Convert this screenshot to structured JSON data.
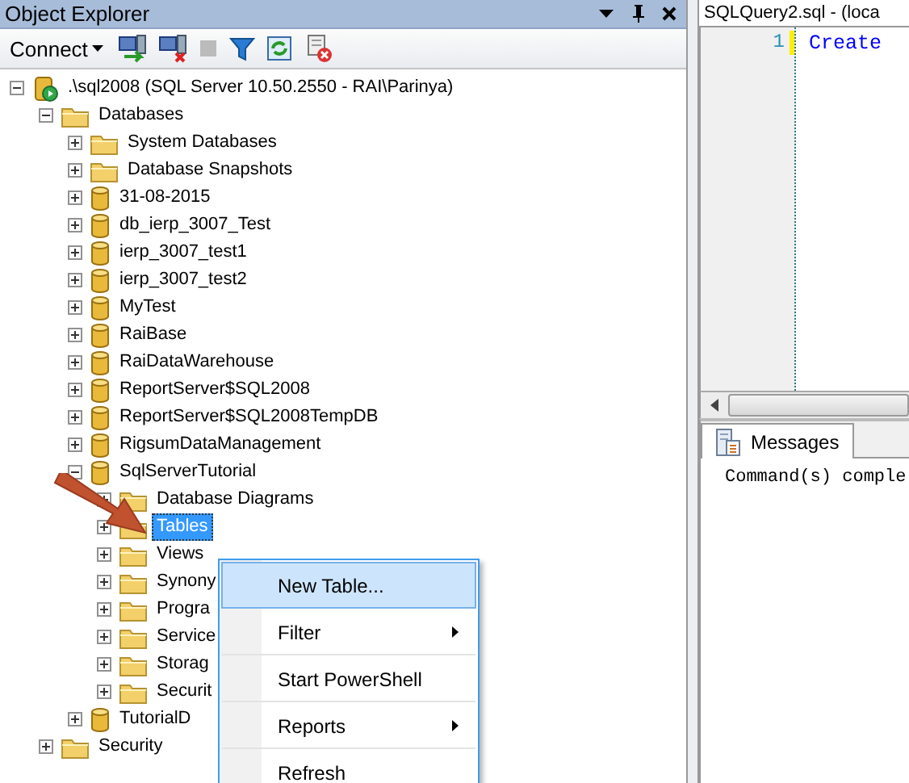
{
  "object_explorer": {
    "title": "Object Explorer",
    "toolbar": {
      "connect": "Connect"
    },
    "tree": [
      {
        "label": ".\\sql2008 (SQL Server 10.50.2550 - RAI\\Parinya)",
        "kind": "server",
        "expanded": true,
        "selected": false,
        "children": [
          {
            "label": "Databases",
            "kind": "folder",
            "expanded": true,
            "selected": false,
            "children": [
              {
                "label": "System Databases",
                "kind": "folder",
                "expanded": false,
                "selected": false
              },
              {
                "label": "Database Snapshots",
                "kind": "folder",
                "expanded": false,
                "selected": false
              },
              {
                "label": "31-08-2015",
                "kind": "database",
                "expanded": false,
                "selected": false
              },
              {
                "label": "db_ierp_3007_Test",
                "kind": "database",
                "expanded": false,
                "selected": false
              },
              {
                "label": "ierp_3007_test1",
                "kind": "database",
                "expanded": false,
                "selected": false
              },
              {
                "label": "ierp_3007_test2",
                "kind": "database",
                "expanded": false,
                "selected": false
              },
              {
                "label": "MyTest",
                "kind": "database",
                "expanded": false,
                "selected": false
              },
              {
                "label": "RaiBase",
                "kind": "database",
                "expanded": false,
                "selected": false
              },
              {
                "label": "RaiDataWarehouse",
                "kind": "database",
                "expanded": false,
                "selected": false
              },
              {
                "label": "ReportServer$SQL2008",
                "kind": "database",
                "expanded": false,
                "selected": false
              },
              {
                "label": "ReportServer$SQL2008TempDB",
                "kind": "database",
                "expanded": false,
                "selected": false
              },
              {
                "label": "RigsumDataManagement",
                "kind": "database",
                "expanded": false,
                "selected": false
              },
              {
                "label": "SqlServerTutorial",
                "kind": "database",
                "expanded": true,
                "selected": false,
                "children": [
                  {
                    "label": "Database Diagrams",
                    "kind": "folder",
                    "expanded": false,
                    "selected": false
                  },
                  {
                    "label": "Tables",
                    "kind": "folder",
                    "expanded": false,
                    "selected": true
                  },
                  {
                    "label": "Views",
                    "kind": "folder",
                    "expanded": false,
                    "selected": false
                  },
                  {
                    "label": "Synony",
                    "kind": "folder",
                    "expanded": false,
                    "selected": false
                  },
                  {
                    "label": "Progra",
                    "kind": "folder",
                    "expanded": false,
                    "selected": false
                  },
                  {
                    "label": "Service",
                    "kind": "folder",
                    "expanded": false,
                    "selected": false
                  },
                  {
                    "label": "Storag",
                    "kind": "folder",
                    "expanded": false,
                    "selected": false
                  },
                  {
                    "label": "Securit",
                    "kind": "folder",
                    "expanded": false,
                    "selected": false
                  }
                ]
              },
              {
                "label": "TutorialD",
                "kind": "database",
                "expanded": false,
                "selected": false
              }
            ]
          },
          {
            "label": "Security",
            "kind": "folder",
            "expanded": false,
            "selected": false
          }
        ]
      }
    ]
  },
  "context_menu": [
    {
      "label": "New Table...",
      "selected": true,
      "submenu": false
    },
    {
      "label": "Filter",
      "selected": false,
      "submenu": true
    },
    {
      "label": "Start PowerShell",
      "selected": false,
      "submenu": false
    },
    {
      "label": "Reports",
      "selected": false,
      "submenu": true
    },
    {
      "label": "Refresh",
      "selected": false,
      "submenu": false
    }
  ],
  "editor": {
    "tab": "SQLQuery2.sql - (loca",
    "line_number": "1",
    "code": "Create"
  },
  "results": {
    "tab": "Messages",
    "message": "Command(s) comple"
  }
}
